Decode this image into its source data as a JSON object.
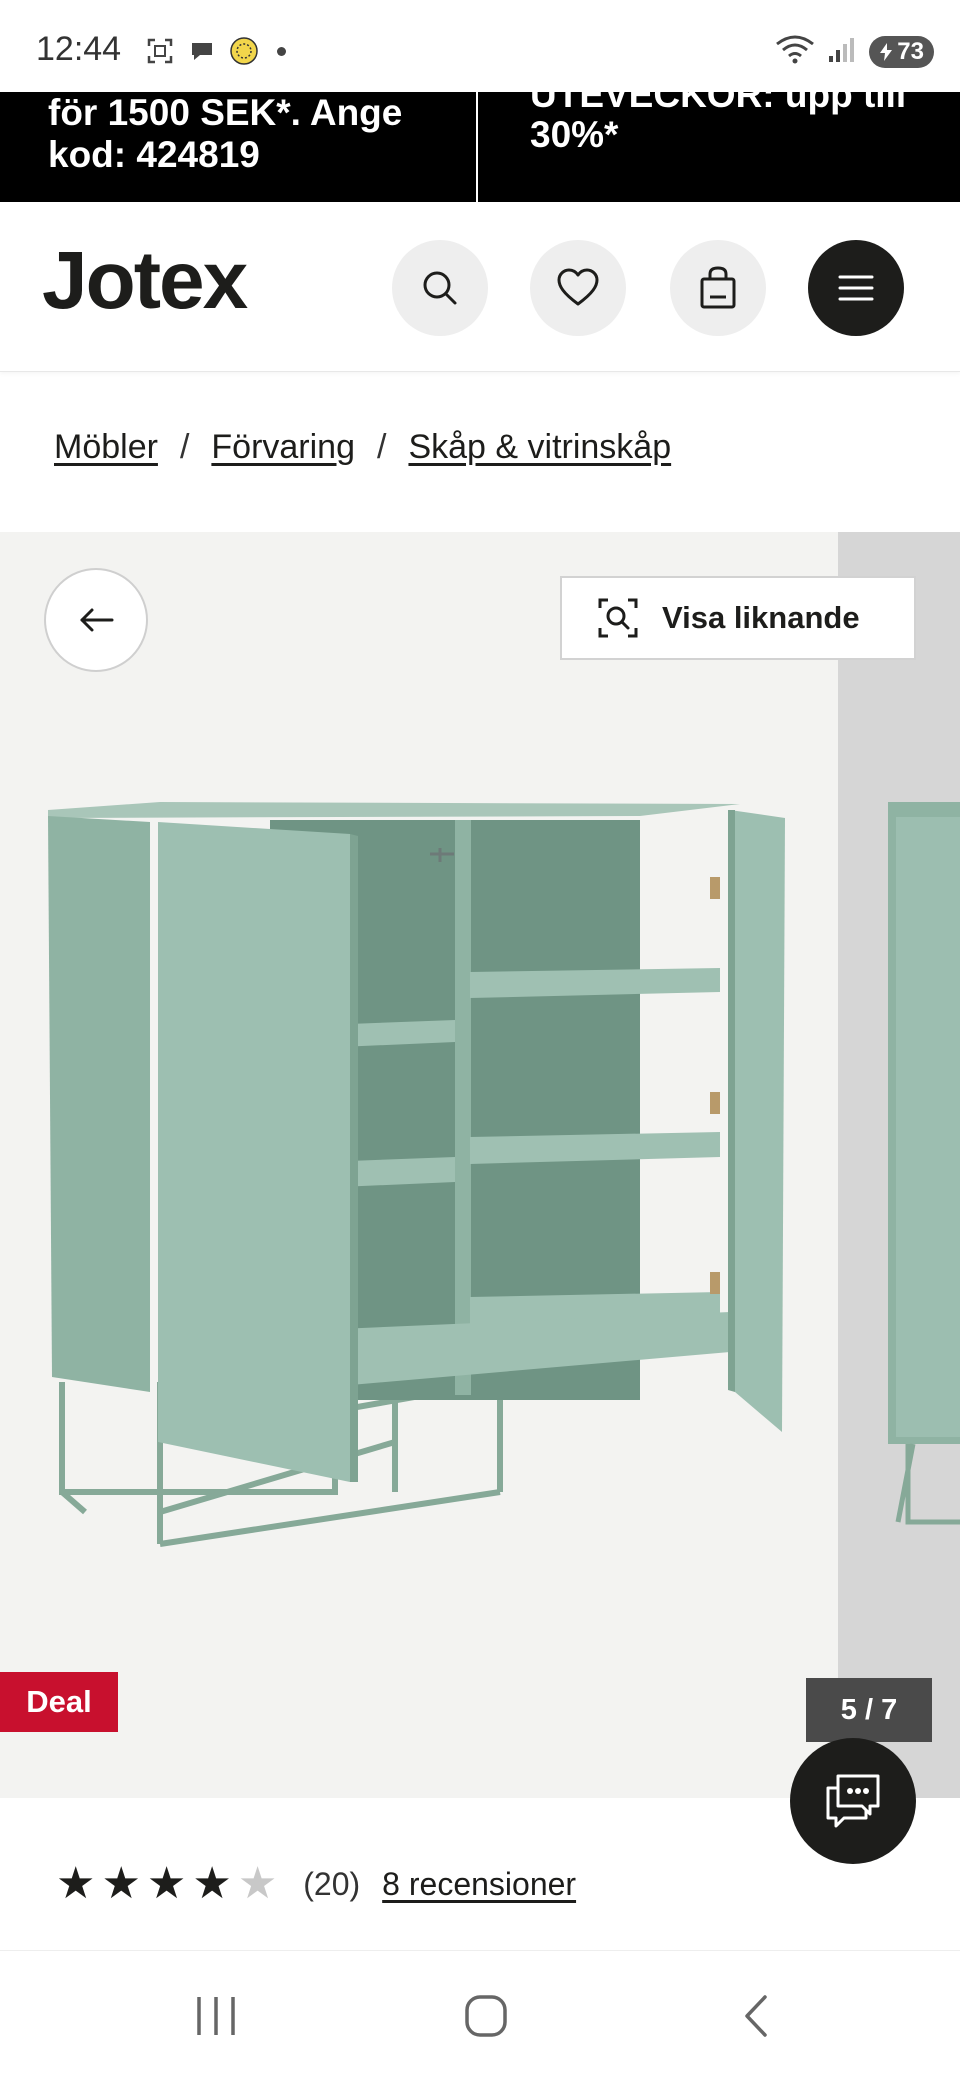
{
  "status_bar": {
    "time": "12:44",
    "battery": "73",
    "icons": [
      "screenshot-icon",
      "chat-bubble-icon",
      "app-badge-icon",
      "wifi-icon",
      "signal-icon",
      "battery-icon"
    ]
  },
  "promo": {
    "left_line1": "för 1500 SEK*. Ange",
    "left_line2": "kod: 424819",
    "right_line1": "UTEVECKOR: upp till",
    "right_line2": "30%*"
  },
  "header": {
    "logo": "Jotex",
    "icons": [
      "search-icon",
      "heart-icon",
      "shopping-bag-icon",
      "menu-icon"
    ]
  },
  "breadcrumb": {
    "items": [
      "Möbler",
      "Förvaring",
      "Skåp & vitrinskåp"
    ],
    "separator": "/"
  },
  "gallery": {
    "similar_label": "Visa liknande",
    "badge": "Deal",
    "counter": "5 / 7",
    "product_color": "#8fb3a3"
  },
  "rating": {
    "stars_filled": 4,
    "stars_total": 5,
    "count": "(20)",
    "reviews_link": "8 recensioner"
  },
  "colors": {
    "brand_dark": "#1d1d1b",
    "deal_red": "#c8102e",
    "promo_bg": "#000000"
  }
}
